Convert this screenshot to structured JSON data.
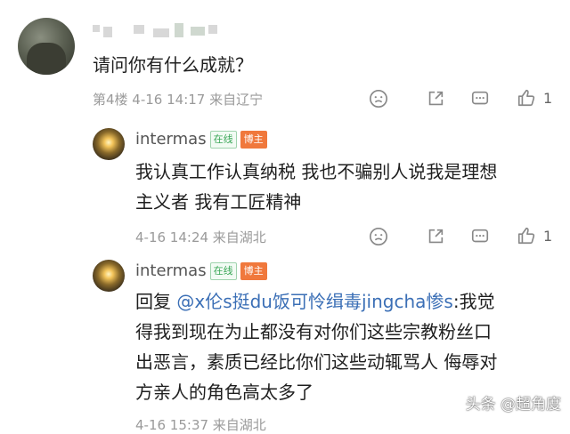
{
  "comments": [
    {
      "text": "请问你有什么成就？",
      "meta": "第4楼  4-16 14:17  来自辽宁",
      "like_count": "1"
    }
  ],
  "replies": [
    {
      "username": "intermas",
      "badge_online": "在线",
      "badge_blogger": "博主",
      "text_lines": [
        "我认真工作认真纳税 我也不骗别人说我是理想",
        "主义者  我有工匠精神"
      ],
      "meta": "4-16 14:24  来自湖北",
      "like_count": "1"
    },
    {
      "username": "intermas",
      "badge_online": "在线",
      "badge_blogger": "博主",
      "reply_prefix": "回复 ",
      "mention": "@x伦s挺du饭可怜缉毒jingcha惨s",
      "text_lines": [
        ":我觉",
        "得我到现在为止都没有对你们这些宗教粉丝口",
        "出恶言，素质已经比你们这些动辄骂人 侮辱对",
        "方亲人的角色高太多了"
      ],
      "meta": "4-16 15:37  来自湖北"
    }
  ],
  "watermark": "头条 @超角度",
  "icons": [
    "emoji-icon",
    "share-icon",
    "comment-icon",
    "thumbs-up-icon"
  ],
  "colors": {
    "online_badge": "#3aa757",
    "blogger_badge": "#f0783c",
    "mention": "#3b6fb6"
  }
}
